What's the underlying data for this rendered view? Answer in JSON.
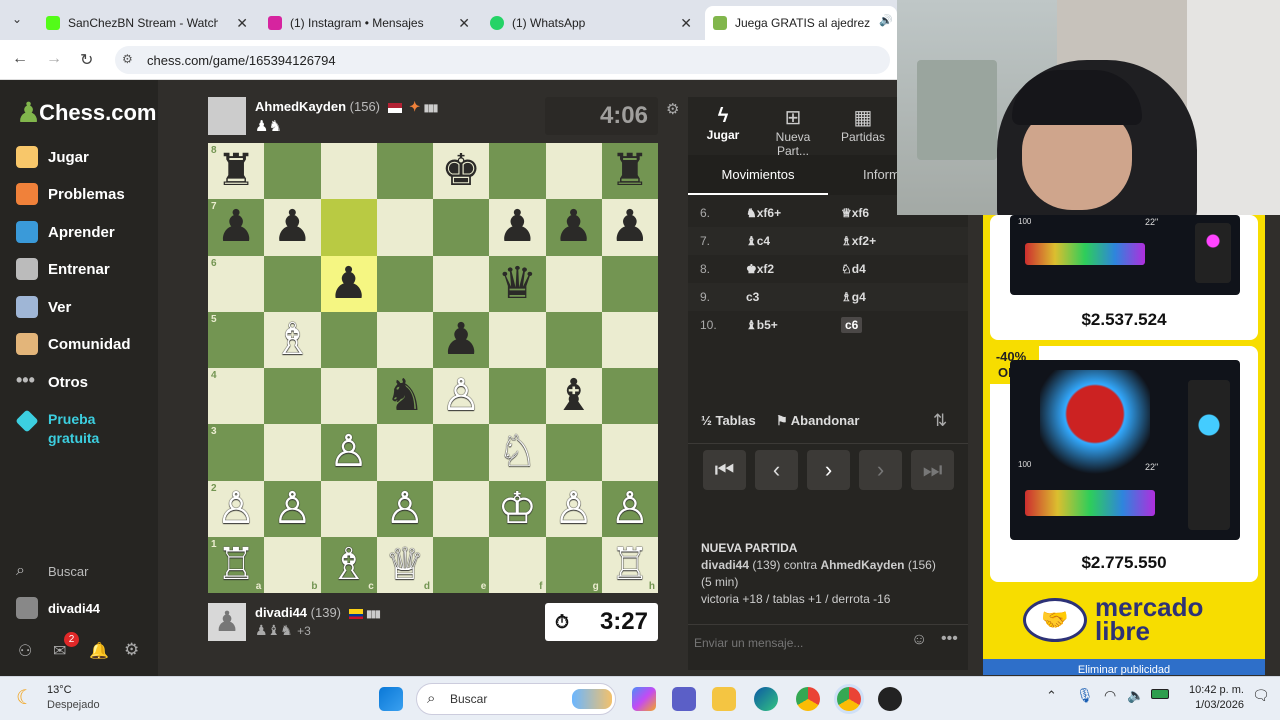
{
  "browser": {
    "tabs": [
      {
        "title": "SanChezBN Stream - Watch Live",
        "color": "#53fc18"
      },
      {
        "title": "(1) Instagram • Mensajes",
        "color": "#d6249f"
      },
      {
        "title": "(1) WhatsApp",
        "color": "#25d366"
      },
      {
        "title": "Juega GRATIS al ajedrez online",
        "color": "#81b64c"
      }
    ],
    "url": "chess.com/game/165394126794"
  },
  "sidebar": {
    "logo": "Chess.com",
    "items": [
      {
        "label": "Jugar",
        "color": "#f8c76a"
      },
      {
        "label": "Problemas",
        "color": "#f0813a"
      },
      {
        "label": "Aprender",
        "color": "#3a9ad9"
      },
      {
        "label": "Entrenar",
        "color": "#bbbbbb"
      },
      {
        "label": "Ver",
        "color": "#9fb6d6"
      },
      {
        "label": "Comunidad",
        "color": "#e3b57a"
      },
      {
        "label": "Otros",
        "color": "#bbbbbb"
      },
      {
        "label": "Prueba gratuita",
        "color": "#3ccfe0"
      }
    ],
    "search_label": "Buscar",
    "user": "divadi44",
    "notif_badge": "2"
  },
  "game": {
    "top_player": {
      "name": "AhmedKayden",
      "rating": "(156)",
      "captured": "♟♞",
      "clock": "4:06"
    },
    "bottom_player": {
      "name": "divadi44",
      "rating": "(139)",
      "captured": "♟♝♞",
      "material": "+3",
      "clock": "3:27"
    },
    "files": [
      "a",
      "b",
      "c",
      "d",
      "e",
      "f",
      "g",
      "h"
    ],
    "ranks": [
      "8",
      "7",
      "6",
      "5",
      "4",
      "3",
      "2",
      "1"
    ],
    "pieces": [
      {
        "sq": "a8",
        "p": "♜",
        "c": "b"
      },
      {
        "sq": "e8",
        "p": "♚",
        "c": "b"
      },
      {
        "sq": "h8",
        "p": "♜",
        "c": "b"
      },
      {
        "sq": "a7",
        "p": "♟",
        "c": "b"
      },
      {
        "sq": "b7",
        "p": "♟",
        "c": "b"
      },
      {
        "sq": "f7",
        "p": "♟",
        "c": "b"
      },
      {
        "sq": "g7",
        "p": "♟",
        "c": "b"
      },
      {
        "sq": "h7",
        "p": "♟",
        "c": "b"
      },
      {
        "sq": "c6",
        "p": "♟",
        "c": "b"
      },
      {
        "sq": "f6",
        "p": "♛",
        "c": "b"
      },
      {
        "sq": "b5",
        "p": "♗",
        "c": "w"
      },
      {
        "sq": "e5",
        "p": "♟",
        "c": "b"
      },
      {
        "sq": "d4",
        "p": "♞",
        "c": "b"
      },
      {
        "sq": "e4",
        "p": "♙",
        "c": "w"
      },
      {
        "sq": "g4",
        "p": "♝",
        "c": "b"
      },
      {
        "sq": "c3",
        "p": "♙",
        "c": "w"
      },
      {
        "sq": "f3",
        "p": "♘",
        "c": "w"
      },
      {
        "sq": "a2",
        "p": "♙",
        "c": "w"
      },
      {
        "sq": "b2",
        "p": "♙",
        "c": "w"
      },
      {
        "sq": "d2",
        "p": "♙",
        "c": "w"
      },
      {
        "sq": "f2",
        "p": "♔",
        "c": "w"
      },
      {
        "sq": "g2",
        "p": "♙",
        "c": "w"
      },
      {
        "sq": "h2",
        "p": "♙",
        "c": "w"
      },
      {
        "sq": "a1",
        "p": "♖",
        "c": "w"
      },
      {
        "sq": "c1",
        "p": "♗",
        "c": "w"
      },
      {
        "sq": "d1",
        "p": "♕",
        "c": "w"
      },
      {
        "sq": "h1",
        "p": "♖",
        "c": "w"
      }
    ],
    "highlights": [
      "c7",
      "c6"
    ]
  },
  "panel": {
    "tabs": [
      "Jugar",
      "Nueva Part...",
      "Partidas"
    ],
    "subtabs": [
      "Movimientos",
      "Inform"
    ],
    "moves": [
      {
        "n": "6.",
        "w": "♞xf6+",
        "b": "♕xf6"
      },
      {
        "n": "7.",
        "w": "♝c4",
        "b": "♗xf2+"
      },
      {
        "n": "8.",
        "w": "♚xf2",
        "b": "♘d4"
      },
      {
        "n": "9.",
        "w": "c3",
        "b": "♗g4"
      },
      {
        "n": "10.",
        "w": "♝b5+",
        "b": "c6"
      }
    ],
    "draw_label": "Tablas",
    "draw_prefix": "½",
    "resign_label": "Abandonar",
    "new_game_title": "NUEVA PARTIDA",
    "new_game_white": "divadi44",
    "new_game_white_rating": "(139)",
    "new_game_vs": "contra",
    "new_game_black": "AhmedKayden",
    "new_game_black_rating": "(156)",
    "new_game_time": "(5 min)",
    "new_game_stats": "victoria +18 / tablas +1 / derrota -16",
    "message_placeholder": "Enviar un mensaje..."
  },
  "ads": {
    "price1": "$2.537.524",
    "discount": "-40%",
    "discount_sub": "OFF",
    "price2": "$2.775.550",
    "brand_line1": "mercado",
    "brand_line2": "libre",
    "remove_ads": "Eliminar publicidad",
    "monitor_size": "22\"",
    "monitor_small": "100"
  },
  "taskbar": {
    "weather_temp": "13°C",
    "weather_desc": "Despejado",
    "search": "Buscar",
    "time": "10:42 p. m.",
    "date": "1/03/2026"
  }
}
